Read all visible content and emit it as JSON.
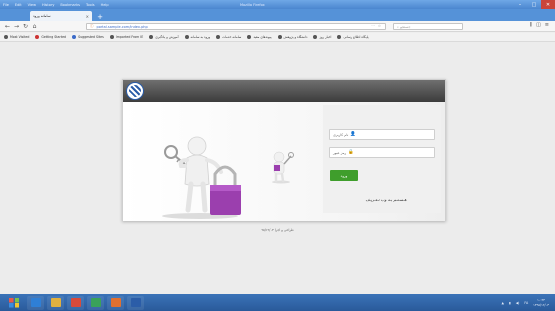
{
  "window": {
    "menu": [
      "File",
      "Edit",
      "View",
      "History",
      "Bookmarks",
      "Tools",
      "Help"
    ],
    "title": "Mozilla Firefox"
  },
  "tab": {
    "label": "سامانه ورود"
  },
  "nav": {
    "url": "portal.sample.com/index.php",
    "search_placeholder": "جستجو"
  },
  "bookmarks": [
    {
      "label": "Most Visited",
      "color": "#555555"
    },
    {
      "label": "Getting Started",
      "color": "#cc3333"
    },
    {
      "label": "Suggested Sites",
      "color": "#3a6ac8"
    },
    {
      "label": "Imported From IE",
      "color": "#555555"
    },
    {
      "label": "آموزش و یادگیری",
      "color": "#555555"
    },
    {
      "label": "ورود به سامانه",
      "color": "#555555"
    },
    {
      "label": "سامانه خدمات",
      "color": "#555555"
    },
    {
      "label": "پیوندهای مفید",
      "color": "#555555"
    },
    {
      "label": "دانشگاه و پژوهش",
      "color": "#555555"
    },
    {
      "label": "اخبار روز",
      "color": "#555555"
    },
    {
      "label": "پایگاه اطلاع رسانی",
      "color": "#555555"
    }
  ],
  "login": {
    "username_placeholder": "نام کاربری",
    "password_placeholder": "رمز عبور",
    "submit_label": "ورود",
    "captcha_text": "هـسـتـم بـه وب تـعـریـف"
  },
  "footer": {
    "text": "طراحی و اجرا ۹۵/۱۲/۰۳"
  },
  "taskbar": {
    "apps": [
      {
        "name": "ie",
        "color": "#2f7fd6"
      },
      {
        "name": "folder",
        "color": "#e0b040"
      },
      {
        "name": "media",
        "color": "#d84a3a"
      },
      {
        "name": "chrome",
        "color": "#3aa25a"
      },
      {
        "name": "firefox",
        "color": "#e07030"
      },
      {
        "name": "word",
        "color": "#2b5da8"
      }
    ],
    "lang": "FA",
    "time": "۱۰:۲۴",
    "date": "۱۳۹۵/۱۲/۰۳"
  }
}
